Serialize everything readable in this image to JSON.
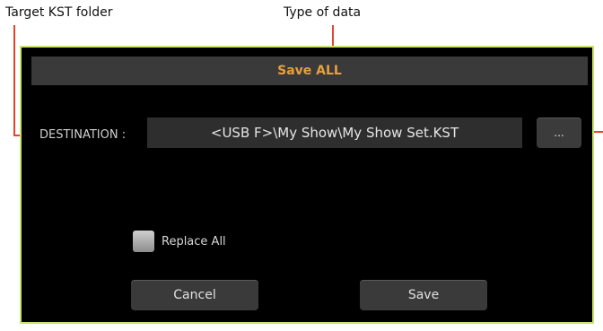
{
  "annotations": {
    "target_folder": "Target KST folder",
    "data_type": "Type of data",
    "callout_color": "#e8412c"
  },
  "dialog": {
    "title": "Save ALL",
    "destination_label": "DESTINATION :",
    "destination_value": "<USB F>\\My Show\\My Show Set.KST",
    "browse_label": "...",
    "replace_all_label": "Replace All",
    "replace_all_checked": false,
    "cancel_label": "Cancel",
    "save_label": "Save"
  },
  "colors": {
    "title_text": "#e6a13a",
    "dialog_border": "#c6e56a",
    "dialog_bg": "#000000"
  }
}
